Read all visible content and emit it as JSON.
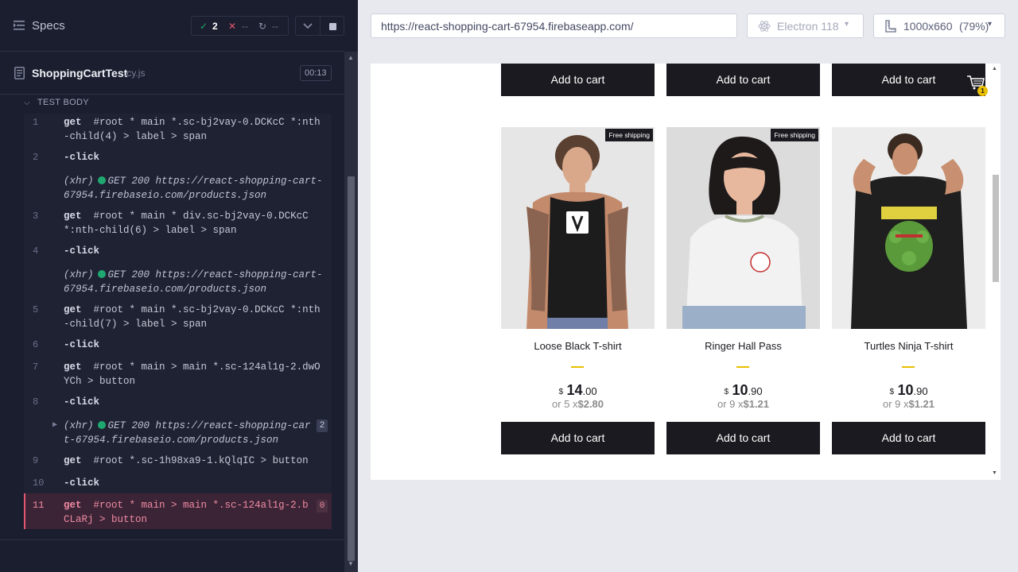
{
  "runner": {
    "specs_label": "Specs",
    "stats": {
      "passed": "2",
      "failed": "--",
      "pending": "--"
    },
    "file": {
      "name": "ShoppingCartTest",
      "ext": ".cy.js",
      "timer": "00:13"
    },
    "test_body_label": "TEST BODY",
    "commands": [
      {
        "num": "1",
        "kw": "get",
        "text": "#root * main *.sc-bj2vay-0.DCKcC *:nth-child(4) > label > span"
      },
      {
        "num": "2",
        "kw": "-click",
        "text": ""
      },
      {
        "num": "",
        "kw": "(xhr)",
        "text": "GET 200 https://react-shopping-cart-67954.firebaseio.com/products.json"
      },
      {
        "num": "3",
        "kw": "get",
        "text": "#root * main * div.sc-bj2vay-0.DCKcC *:nth-child(6) > label > span"
      },
      {
        "num": "4",
        "kw": "-click",
        "text": ""
      },
      {
        "num": "",
        "kw": "(xhr)",
        "text": "GET 200 https://react-shopping-cart-67954.firebaseio.com/products.json"
      },
      {
        "num": "5",
        "kw": "get",
        "text": "#root * main *.sc-bj2vay-0.DCKcC *:nth-child(7) > label > span"
      },
      {
        "num": "6",
        "kw": "-click",
        "text": ""
      },
      {
        "num": "7",
        "kw": "get",
        "text": "#root * main > main *.sc-124al1g-2.dwOYCh > button"
      },
      {
        "num": "8",
        "kw": "-click",
        "text": ""
      },
      {
        "num": "",
        "kw": "(xhr)",
        "text": "GET 200 https://react-shopping-cart-67954.firebaseio.com/products.json",
        "badge": "2"
      },
      {
        "num": "9",
        "kw": "get",
        "text": "#root *.sc-1h98xa9-1.kQlqIC > button"
      },
      {
        "num": "10",
        "kw": "-click",
        "text": ""
      },
      {
        "num": "11",
        "kw": "get",
        "text": "#root * main > main *.sc-124al1g-2.bCLaRj > button",
        "badge": "0"
      }
    ]
  },
  "browser": {
    "url": "https://react-shopping-cart-67954.firebaseapp.com/",
    "engine": "Electron 118",
    "viewport": "1000x660",
    "zoom": "(79%)"
  },
  "shop": {
    "add_to_cart": "Add to cart",
    "cart_count": "1",
    "products": [
      {
        "title": "Loose Black T-shirt",
        "free_shipping": "Free shipping",
        "currency": "$",
        "price_int": "14",
        "price_dec": ".00",
        "installments_prefix": "or 5 x",
        "installment_value": "$2.80"
      },
      {
        "title": "Ringer Hall Pass",
        "free_shipping": "Free shipping",
        "currency": "$",
        "price_int": "10",
        "price_dec": ".90",
        "installments_prefix": "or 9 x",
        "installment_value": "$1.21"
      },
      {
        "title": "Turtles Ninja T-shirt",
        "free_shipping": "",
        "currency": "$",
        "price_int": "10",
        "price_dec": ".90",
        "installments_prefix": "or 9 x",
        "installment_value": "$1.21"
      }
    ]
  }
}
